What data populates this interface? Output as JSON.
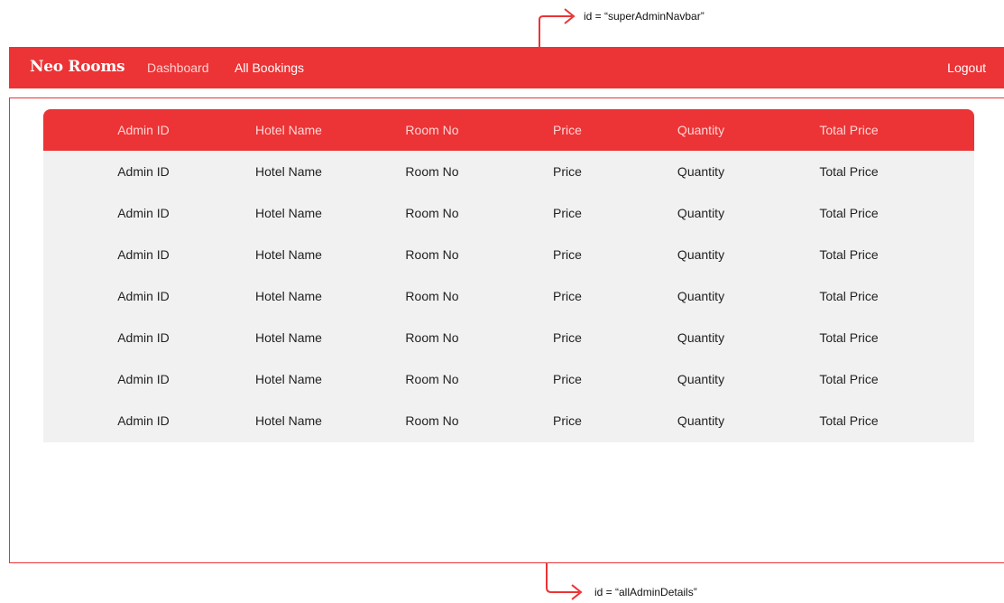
{
  "annotations": {
    "top_label": "id = “superAdminNavbar”",
    "bottom_label": "id = “allAdminDetails”",
    "arrow_color": "#ec3335"
  },
  "navbar": {
    "brand": "Neo Rooms",
    "links": [
      "Dashboard",
      "All Bookings"
    ],
    "logout": "Logout",
    "background": "#ec3335"
  },
  "table": {
    "headers": [
      "Admin ID",
      "Hotel Name",
      "Room No",
      "Price",
      "Quantity",
      "Total Price"
    ],
    "rows": [
      [
        "Admin ID",
        "Hotel Name",
        "Room No",
        "Price",
        "Quantity",
        "Total Price"
      ],
      [
        "Admin ID",
        "Hotel Name",
        "Room No",
        "Price",
        "Quantity",
        "Total Price"
      ],
      [
        "Admin ID",
        "Hotel Name",
        "Room No",
        "Price",
        "Quantity",
        "Total Price"
      ],
      [
        "Admin ID",
        "Hotel Name",
        "Room No",
        "Price",
        "Quantity",
        "Total Price"
      ],
      [
        "Admin ID",
        "Hotel Name",
        "Room No",
        "Price",
        "Quantity",
        "Total Price"
      ],
      [
        "Admin ID",
        "Hotel Name",
        "Room No",
        "Price",
        "Quantity",
        "Total Price"
      ],
      [
        "Admin ID",
        "Hotel Name",
        "Room No",
        "Price",
        "Quantity",
        "Total Price"
      ]
    ]
  }
}
